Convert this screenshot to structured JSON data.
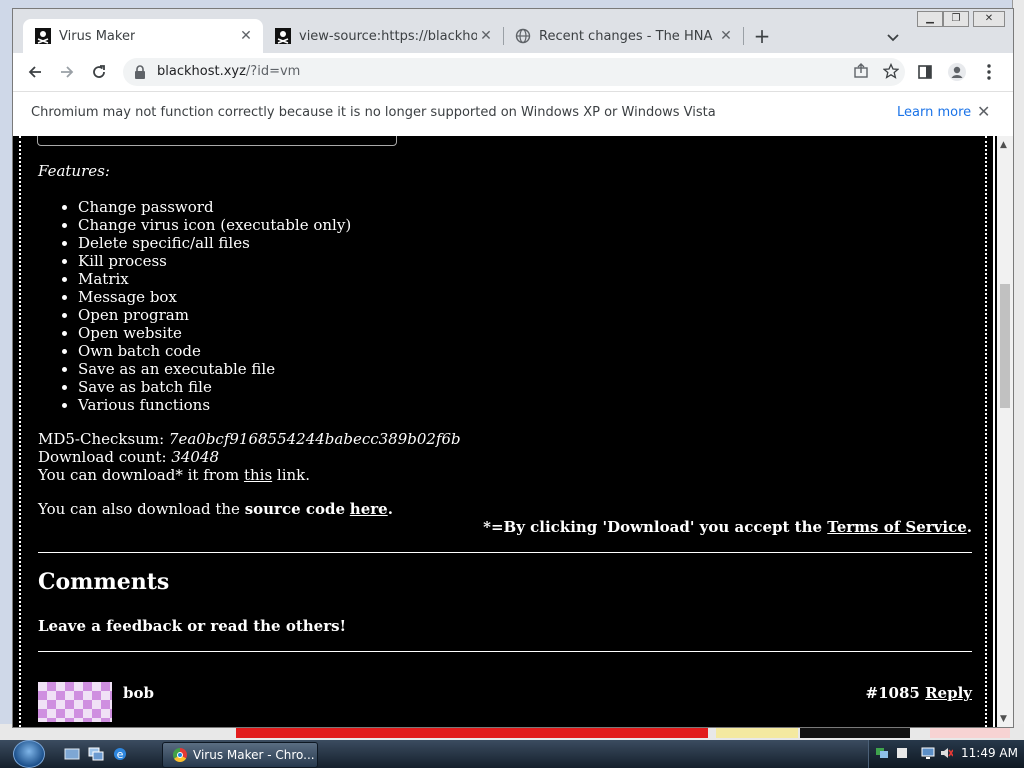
{
  "browser": {
    "tabs": [
      {
        "title": "Virus Maker",
        "active": true
      },
      {
        "title": "view-source:https://blackhost.xyz",
        "active": false
      },
      {
        "title": "Recent changes - The HNA Wiki",
        "active": false
      }
    ],
    "url": "blackhost.xyz",
    "url_path": "/?id=vm"
  },
  "infobar": {
    "message": "Chromium may not function correctly because it is no longer supported on Windows XP or Windows Vista",
    "learn_more": "Learn more"
  },
  "page": {
    "features_label": "Features:",
    "features": [
      "Change password",
      "Change virus icon (executable only)",
      "Delete specific/all files",
      "Kill process",
      "Matrix",
      "Message box",
      "Open program",
      "Open website",
      "Own batch code",
      "Save as an executable file",
      "Save as batch file",
      "Various functions"
    ],
    "md5_label": "MD5-Checksum: ",
    "md5_value": "7ea0bcf9168554244babecc389b02f6b",
    "count_label": "Download count: ",
    "count_value": "34048",
    "download_pre": "You can download* it from ",
    "download_link": "this",
    "download_post": " link.",
    "source_pre": "You can also download the ",
    "source_bold": "source code",
    "source_link": "here",
    "source_post": ".",
    "tos_text": "*=By clicking 'Download' you accept the ",
    "tos_link": "Terms of Service",
    "tos_post": ".",
    "comments_heading": "Comments",
    "comments_sub": "Leave a feedback or read the others!",
    "comment": {
      "name": "bob",
      "id": "#1085",
      "reply": "Reply"
    }
  },
  "taskbar": {
    "task_label": "Virus Maker - Chro...",
    "clock": "11:49 AM"
  }
}
